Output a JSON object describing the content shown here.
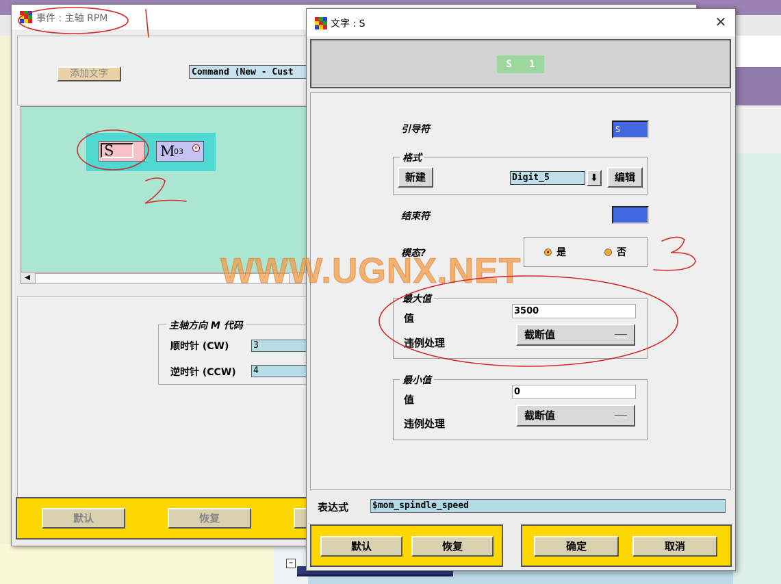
{
  "event_window": {
    "title": "事件 : 主轴 RPM",
    "add_text_button": "添加文字",
    "command_field": "Command (New - Cust",
    "words": {
      "s_letter": "S",
      "m_letter": "M",
      "m_sub": "03"
    },
    "mcode_group": {
      "title": "主轴方向 M 代码",
      "cw_label": "顺时针 (CW)",
      "cw_value": "3",
      "ccw_label": "逆时针 (CCW)",
      "ccw_value": "4"
    },
    "buttons": {
      "default": "默认",
      "restore": "恢复"
    }
  },
  "word_dialog": {
    "title": "文字 : S",
    "close_glyph": "✕",
    "preview_word": "S   1",
    "leader_label": "引导符",
    "leader_value": "S",
    "format_title": "格式",
    "new_button": "新建",
    "format_value": "Digit_5",
    "format_down_glyph": "⬇",
    "edit_button": "编辑",
    "trailer_label": "结束符",
    "modal_label": "模态?",
    "modal_yes": "是",
    "modal_no": "否",
    "max_title": "最大值",
    "max_value_label": "值",
    "max_value": "3500",
    "max_violation_label": "违例处理",
    "max_violation_value": "截断值",
    "min_title": "最小值",
    "min_value_label": "值",
    "min_value": "0",
    "min_violation_label": "违例处理",
    "min_violation_value": "截断值",
    "expression_label": "表达式",
    "expression_value": "$mom_spindle_speed",
    "buttons": {
      "default": "默认",
      "restore": "恢复",
      "ok": "确定",
      "cancel": "取消"
    }
  },
  "watermark": "WWW.UGNX.NET",
  "colors": {
    "canvas_mint": "#ace6d2",
    "footer_yellow": "#ffd700",
    "swatch_blue": "#4466e0",
    "annotation_red": "#d42a2a"
  }
}
